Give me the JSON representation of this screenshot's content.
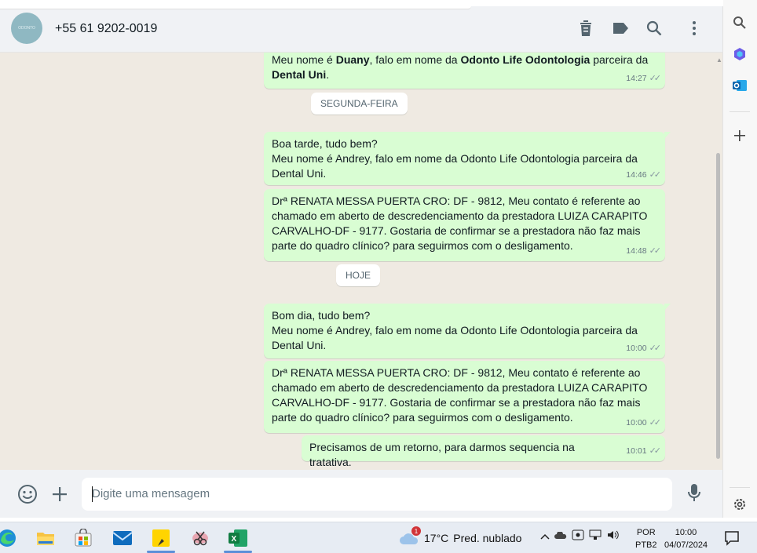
{
  "header": {
    "avatar_text": "ODONTO",
    "contact": "+55 61 9202-0019",
    "icons": [
      "delete-icon",
      "label-icon",
      "search-icon",
      "menu-icon"
    ]
  },
  "messages": [
    {
      "type": "out",
      "html_parts": [
        {
          "t": "Meu nome é "
        },
        {
          "b": "Duany"
        },
        {
          "t": ", falo em nome da "
        },
        {
          "b": "Odonto Life Odontologia"
        },
        {
          "t": " parceira da"
        },
        {
          "br": true
        },
        {
          "b": "Dental Uni"
        },
        {
          "t": "."
        }
      ],
      "time": "14:27"
    },
    {
      "type": "date",
      "label": "SEGUNDA-FEIRA"
    },
    {
      "type": "out",
      "text_lines": [
        "Boa tarde, tudo bem?",
        "Meu nome é Andrey, falo em nome da Odonto Life Odontologia parceira da",
        "Dental Uni."
      ],
      "time": "14:46"
    },
    {
      "type": "out",
      "text_lines": [
        "Drª RENATA MESSA PUERTA CRO: DF - 9812, Meu contato é referente ao",
        "chamado em aberto de descredenciamento da prestadora  LUIZA CARAPITO",
        "CARVALHO-DF - 9177. Gostaria de confirmar se a prestadora não faz mais",
        "parte do quadro clínico? para seguirmos com o desligamento."
      ],
      "time": "14:48"
    },
    {
      "type": "date",
      "label": "HOJE"
    },
    {
      "type": "out",
      "text_lines": [
        "Bom dia, tudo bem?",
        "Meu nome é Andrey, falo em nome da Odonto Life Odontologia parceira da",
        "Dental Uni."
      ],
      "time": "10:00"
    },
    {
      "type": "out",
      "text_lines": [
        "Drª RENATA MESSA PUERTA CRO: DF - 9812, Meu contato é referente ao",
        "chamado em aberto de descredenciamento da prestadora  LUIZA CARAPITO",
        "CARVALHO-DF - 9177. Gostaria de confirmar se a prestadora não faz mais",
        "parte do quadro clínico? para seguirmos com o desligamento."
      ],
      "time": "10:00"
    },
    {
      "type": "out",
      "text_lines": [
        "Precisamos de um retorno, para darmos sequencia na tratativa."
      ],
      "time": "10:01"
    }
  ],
  "footer": {
    "placeholder": "Digite uma mensagem",
    "icons": [
      "emoji-icon",
      "attach-plus-icon",
      "microphone-icon"
    ]
  },
  "sidebar": {
    "icons": [
      "search-icon",
      "copilot-icon",
      "outlook-icon",
      "add-icon",
      "settings-icon"
    ]
  },
  "taskbar": {
    "apps": [
      "edge-icon",
      "file-explorer-icon",
      "store-icon",
      "mail-icon",
      "sticky-notes-icon",
      "snipping-tool-icon",
      "excel-icon"
    ],
    "weather": {
      "badge": "1",
      "temp": "17°C",
      "desc": "Pred. nublado"
    },
    "lang": {
      "line1": "POR",
      "line2": "PTB2"
    },
    "clock": {
      "time": "10:00",
      "date": "04/07/2024"
    }
  },
  "colors": {
    "bubble_out": "#d9fdd3",
    "chat_bg": "#efeae2",
    "header_bg": "#f0f2f5",
    "accent": "#00a884"
  }
}
